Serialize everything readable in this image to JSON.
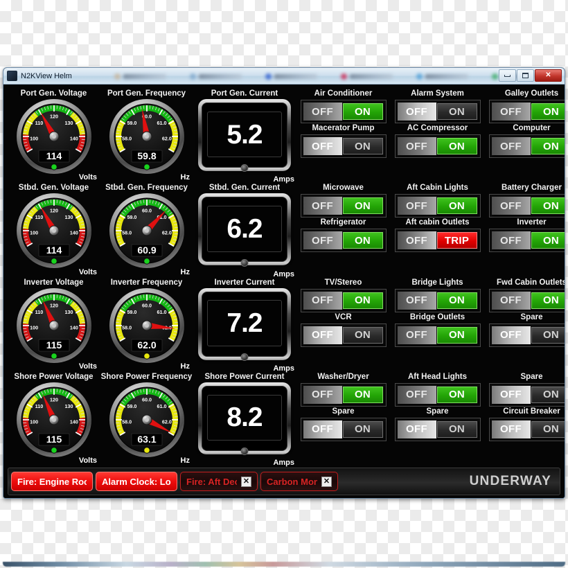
{
  "window": {
    "title": "N2KView Helm",
    "buttons": {
      "minimize": "",
      "maximize": "",
      "close": "✕"
    }
  },
  "ghost_tabs": [
    {
      "color": "#c8b49a"
    },
    {
      "color": "#7fa8cc"
    },
    {
      "color": "#2f5fd0"
    },
    {
      "color": "#cc2a55"
    },
    {
      "color": "#4f9fd8"
    },
    {
      "color": "#3fae6a"
    }
  ],
  "gauges": [
    {
      "label": "Port Gen. Voltage",
      "value": "114",
      "unit": "Volts",
      "needle": 114,
      "min": 95,
      "max": 145,
      "ticks": [
        "100",
        "110",
        "120",
        "130",
        "140"
      ],
      "tick_values": [
        100,
        110,
        120,
        130,
        140
      ],
      "led": "#19d31e",
      "bands": [
        {
          "from": 95,
          "to": 102,
          "color": "#d41616"
        },
        {
          "from": 102,
          "to": 112,
          "color": "#e8e80e"
        },
        {
          "from": 112,
          "to": 128,
          "color": "#14b814"
        },
        {
          "from": 128,
          "to": 138,
          "color": "#e8e80e"
        },
        {
          "from": 138,
          "to": 145,
          "color": "#d41616"
        }
      ]
    },
    {
      "label": "Port Gen. Frequency",
      "value": "59.8",
      "unit": "Hz",
      "needle": 59.8,
      "min": 57.5,
      "max": 62.5,
      "ticks": [
        "58.0",
        "59.0",
        "60.0",
        "61.0",
        "62.0"
      ],
      "tick_values": [
        58,
        59,
        60,
        61,
        62
      ],
      "led": "#19d31e",
      "bands": [
        {
          "from": 57.5,
          "to": 58.8,
          "color": "#e8e80e"
        },
        {
          "from": 58.8,
          "to": 61.2,
          "color": "#14b814"
        },
        {
          "from": 61.2,
          "to": 62.5,
          "color": "#e8e80e"
        }
      ]
    },
    {
      "label": "Stbd. Gen. Voltage",
      "value": "114",
      "unit": "Volts",
      "needle": 114,
      "min": 95,
      "max": 145,
      "ticks": [
        "100",
        "110",
        "120",
        "130",
        "140"
      ],
      "tick_values": [
        100,
        110,
        120,
        130,
        140
      ],
      "led": "#19d31e",
      "bands": [
        {
          "from": 95,
          "to": 102,
          "color": "#d41616"
        },
        {
          "from": 102,
          "to": 112,
          "color": "#e8e80e"
        },
        {
          "from": 112,
          "to": 128,
          "color": "#14b814"
        },
        {
          "from": 128,
          "to": 138,
          "color": "#e8e80e"
        },
        {
          "from": 138,
          "to": 145,
          "color": "#d41616"
        }
      ]
    },
    {
      "label": "Stbd. Gen. Frequency",
      "value": "60.9",
      "unit": "Hz",
      "needle": 60.9,
      "min": 57.5,
      "max": 62.5,
      "ticks": [
        "58.0",
        "59.0",
        "60.0",
        "61.0",
        "62.0"
      ],
      "tick_values": [
        58,
        59,
        60,
        61,
        62
      ],
      "led": "#19d31e",
      "bands": [
        {
          "from": 57.5,
          "to": 58.8,
          "color": "#e8e80e"
        },
        {
          "from": 58.8,
          "to": 61.2,
          "color": "#14b814"
        },
        {
          "from": 61.2,
          "to": 62.5,
          "color": "#e8e80e"
        }
      ]
    },
    {
      "label": "Inverter Voltage",
      "value": "115",
      "unit": "Volts",
      "needle": 115,
      "min": 95,
      "max": 145,
      "ticks": [
        "100",
        "110",
        "120",
        "130",
        "140"
      ],
      "tick_values": [
        100,
        110,
        120,
        130,
        140
      ],
      "led": "#19d31e",
      "bands": [
        {
          "from": 95,
          "to": 102,
          "color": "#d41616"
        },
        {
          "from": 102,
          "to": 112,
          "color": "#e8e80e"
        },
        {
          "from": 112,
          "to": 128,
          "color": "#14b814"
        },
        {
          "from": 128,
          "to": 138,
          "color": "#e8e80e"
        },
        {
          "from": 138,
          "to": 145,
          "color": "#d41616"
        }
      ]
    },
    {
      "label": "Inverter Frequency",
      "value": "62.0",
      "unit": "Hz",
      "needle": 62.0,
      "min": 57.5,
      "max": 62.5,
      "ticks": [
        "58.0",
        "59.0",
        "60.0",
        "61.0",
        "62.0"
      ],
      "tick_values": [
        58,
        59,
        60,
        61,
        62
      ],
      "led": "#e8e80e",
      "bands": [
        {
          "from": 57.5,
          "to": 58.8,
          "color": "#e8e80e"
        },
        {
          "from": 58.8,
          "to": 61.2,
          "color": "#14b814"
        },
        {
          "from": 61.2,
          "to": 62.5,
          "color": "#e8e80e"
        }
      ]
    },
    {
      "label": "Shore Power Voltage",
      "value": "115",
      "unit": "Volts",
      "needle": 115,
      "min": 95,
      "max": 145,
      "ticks": [
        "100",
        "110",
        "120",
        "130",
        "140"
      ],
      "tick_values": [
        100,
        110,
        120,
        130,
        140
      ],
      "led": "#19d31e",
      "bands": [
        {
          "from": 95,
          "to": 102,
          "color": "#d41616"
        },
        {
          "from": 102,
          "to": 112,
          "color": "#e8e80e"
        },
        {
          "from": 112,
          "to": 128,
          "color": "#14b814"
        },
        {
          "from": 128,
          "to": 138,
          "color": "#e8e80e"
        },
        {
          "from": 138,
          "to": 145,
          "color": "#d41616"
        }
      ]
    },
    {
      "label": "Shore Power Frequency",
      "value": "63.1",
      "unit": "Hz",
      "needle": 62.45,
      "min": 57.5,
      "max": 62.5,
      "ticks": [
        "58.0",
        "59.0",
        "60.0",
        "61.0",
        "62.0"
      ],
      "tick_values": [
        58,
        59,
        60,
        61,
        62
      ],
      "led": "#e8e80e",
      "bands": [
        {
          "from": 57.5,
          "to": 58.8,
          "color": "#e8e80e"
        },
        {
          "from": 58.8,
          "to": 61.2,
          "color": "#14b814"
        },
        {
          "from": 61.2,
          "to": 62.5,
          "color": "#e8e80e"
        }
      ]
    }
  ],
  "digitals": [
    {
      "label": "Port Gen. Current",
      "value": "5.2",
      "unit": "Amps"
    },
    {
      "label": "Stbd. Gen. Current",
      "value": "6.2",
      "unit": "Amps"
    },
    {
      "label": "Inverter Current",
      "value": "7.2",
      "unit": "Amps"
    },
    {
      "label": "Shore Power Current",
      "value": "8.2",
      "unit": "Amps"
    }
  ],
  "switch_labels": {
    "off": "OFF",
    "on": "ON",
    "trip": "TRIP"
  },
  "switches": [
    {
      "label": "Air Conditioner",
      "state": "on"
    },
    {
      "label": "Alarm System",
      "state": "off"
    },
    {
      "label": "Galley Outlets",
      "state": "on"
    },
    {
      "label": "Macerator Pump",
      "state": "off"
    },
    {
      "label": "AC Compressor",
      "state": "on"
    },
    {
      "label": "Computer",
      "state": "on"
    },
    {
      "label": "Microwave",
      "state": "on"
    },
    {
      "label": "Aft Cabin Lights",
      "state": "on"
    },
    {
      "label": "Battery Charger",
      "state": "on"
    },
    {
      "label": "Refrigerator",
      "state": "on"
    },
    {
      "label": "Aft cabin Outlets",
      "state": "trip"
    },
    {
      "label": "Inverter",
      "state": "on"
    },
    {
      "label": "TV/Stereo",
      "state": "on"
    },
    {
      "label": "Bridge Lights",
      "state": "on"
    },
    {
      "label": "Fwd Cabin Outlets",
      "state": "on"
    },
    {
      "label": "VCR",
      "state": "off"
    },
    {
      "label": "Bridge Outlets",
      "state": "on"
    },
    {
      "label": "Spare",
      "state": "off"
    },
    {
      "label": "Washer/Dryer",
      "state": "on"
    },
    {
      "label": "Aft Head Lights",
      "state": "on"
    },
    {
      "label": "Spare",
      "state": "off"
    },
    {
      "label": "Spare",
      "state": "off"
    },
    {
      "label": "Spare",
      "state": "off"
    },
    {
      "label": "Circuit Breaker",
      "state": "off"
    }
  ],
  "alarms": [
    {
      "label": "Fire: Engine Room",
      "state": "active",
      "dismiss": ""
    },
    {
      "label": "Alarm Clock: Local",
      "state": "active",
      "dismiss": ""
    },
    {
      "label": "Fire: Aft Deck",
      "state": "ack",
      "dismiss": "✕"
    },
    {
      "label": "Carbon Monoxide",
      "state": "ack",
      "dismiss": "✕"
    }
  ],
  "status": "UNDERWAY"
}
